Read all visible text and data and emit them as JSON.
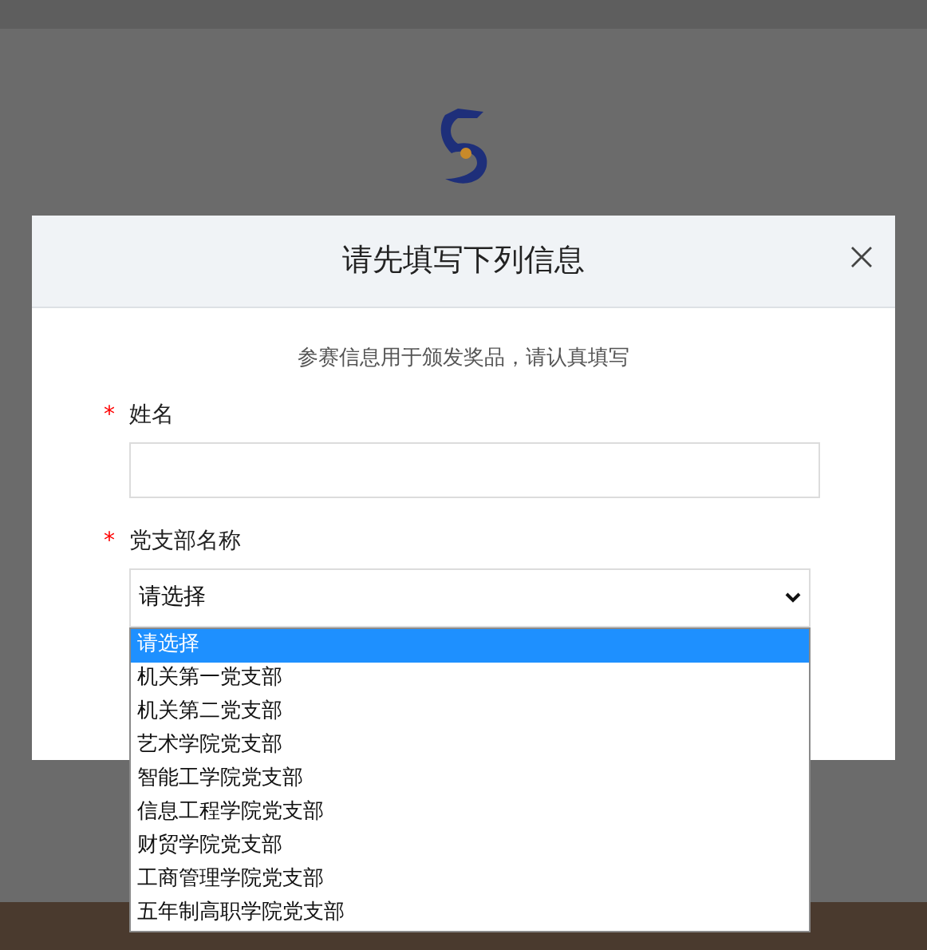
{
  "dialog": {
    "title": "请先填写下列信息",
    "subtitle": "参赛信息用于颁发奖品，请认真填写",
    "fields": [
      {
        "kind": "text",
        "label": "姓名",
        "required_mark": "*"
      },
      {
        "kind": "select",
        "label": "党支部名称",
        "required_mark": "*",
        "value": "请选择",
        "expanded": true,
        "options": [
          {
            "label": "请选择",
            "selected": true
          },
          {
            "label": "机关第一党支部",
            "selected": false
          },
          {
            "label": "机关第二党支部",
            "selected": false
          },
          {
            "label": "艺术学院党支部",
            "selected": false
          },
          {
            "label": "智能工学院党支部",
            "selected": false
          },
          {
            "label": "信息工程学院党支部",
            "selected": false
          },
          {
            "label": "财贸学院党支部",
            "selected": false
          },
          {
            "label": "工商管理学院党支部",
            "selected": false
          },
          {
            "label": "五年制高职学院党支部",
            "selected": false
          }
        ]
      }
    ]
  }
}
